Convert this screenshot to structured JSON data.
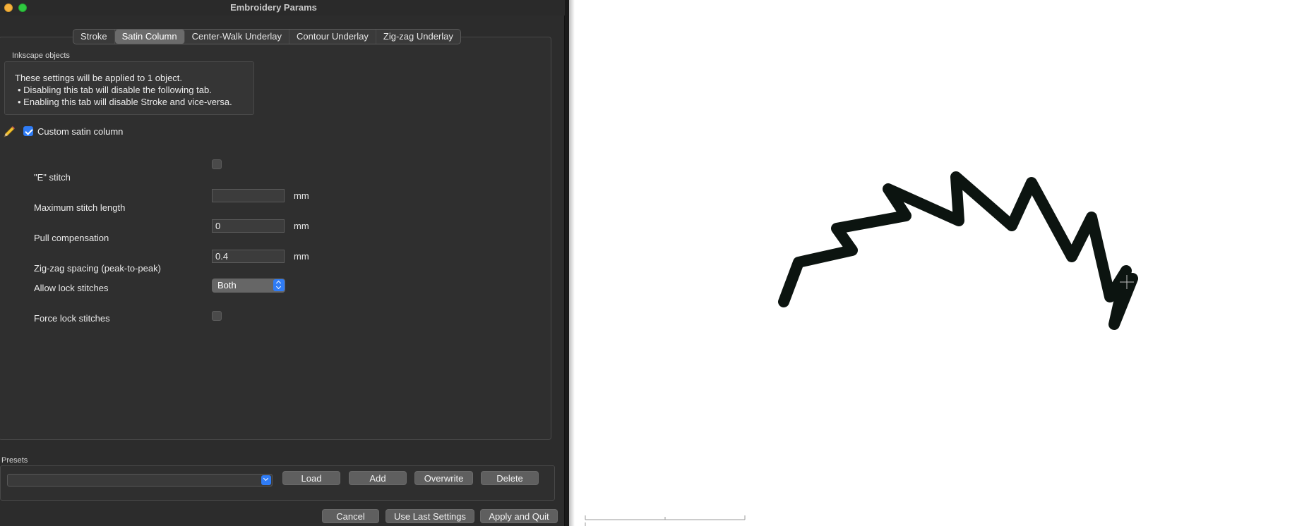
{
  "window": {
    "title": "Embroidery Params"
  },
  "tabs": [
    {
      "label": "Stroke",
      "active": false
    },
    {
      "label": "Satin Column",
      "active": true
    },
    {
      "label": "Center-Walk Underlay",
      "active": false
    },
    {
      "label": "Contour Underlay",
      "active": false
    },
    {
      "label": "Zig-zag Underlay",
      "active": false
    }
  ],
  "info": {
    "group_label": "Inkscape objects",
    "line1": "These settings will be applied to 1 object.",
    "line2": "• Disabling this tab will disable the following tab.",
    "line3": "• Enabling this tab will disable Stroke and vice-versa."
  },
  "custom_satin": {
    "label": "Custom satin column",
    "checked": true
  },
  "params": {
    "e_stitch": {
      "label": "\"E\" stitch",
      "checked": false
    },
    "max_stitch_length": {
      "label": "Maximum stitch length",
      "value": "",
      "unit": "mm"
    },
    "pull_compensation": {
      "label": "Pull compensation",
      "value": "0",
      "unit": "mm"
    },
    "zigzag_spacing": {
      "label": "Zig-zag spacing (peak-to-peak)",
      "value": "0.4",
      "unit": "mm"
    },
    "allow_lock_stitches": {
      "label": "Allow lock stitches",
      "value": "Both"
    },
    "force_lock_stitches": {
      "label": "Force lock stitches",
      "checked": false
    }
  },
  "presets": {
    "label": "Presets",
    "selected": "",
    "load_label": "Load",
    "add_label": "Add",
    "overwrite_label": "Overwrite",
    "delete_label": "Delete"
  },
  "footer": {
    "cancel_label": "Cancel",
    "use_last_label": "Use Last Settings",
    "apply_quit_label": "Apply and Quit"
  },
  "colors": {
    "accent": "#2f7cf6",
    "dialog_bg": "#2c2c2c",
    "stroke_path": "#0c1410"
  }
}
